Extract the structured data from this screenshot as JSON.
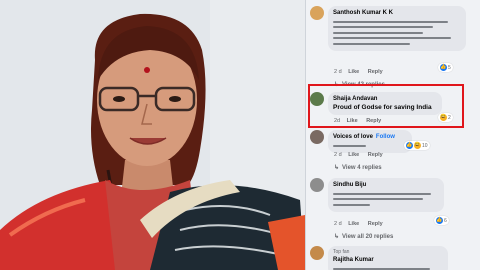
{
  "comments": [
    {
      "author": "Santhosh Kumar K K",
      "time": "2 d",
      "actions": [
        "Like",
        "Reply"
      ],
      "reaction_count": "5",
      "reactions": [
        "like-icon"
      ]
    },
    {
      "author": "Shaija Andavan",
      "text": "Proud of Godse for saving India",
      "time": "2d",
      "actions": [
        "Like",
        "Reply"
      ],
      "reaction_count": "2",
      "reactions": [
        "haha-icon"
      ]
    },
    {
      "author": "Voices of love",
      "follow": "Follow",
      "time": "2 d",
      "actions": [
        "Like",
        "Reply"
      ],
      "reaction_count": "10",
      "reactions": [
        "like-icon",
        "haha-icon"
      ]
    },
    {
      "author": "Sindhu Biju",
      "time": "2 d",
      "actions": [
        "Like",
        "Reply"
      ],
      "reaction_count": "6",
      "reactions": [
        "like-icon"
      ]
    },
    {
      "top_label": "Top fan",
      "author": "Rajitha Kumar"
    }
  ],
  "replies_links": [
    "View 42 replies",
    "View 4 replies",
    "View all 20 replies"
  ],
  "colors": {
    "highlight": "#e0161b",
    "link": "#1877f2",
    "bubble": "#e4e6eb",
    "panel": "#f0f2f5"
  }
}
